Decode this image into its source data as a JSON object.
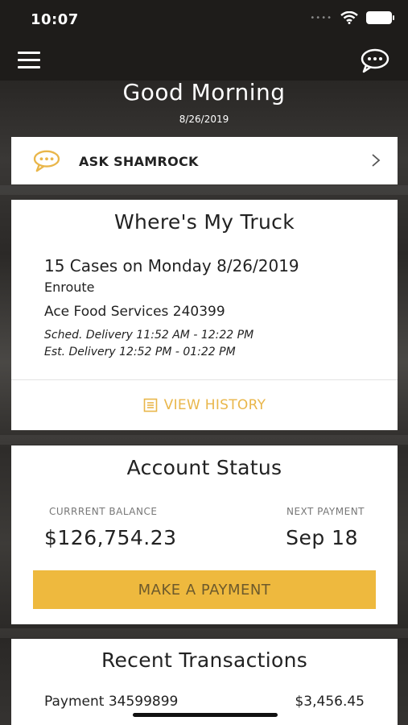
{
  "status_bar": {
    "time": "10:07"
  },
  "header": {
    "greeting": "Good Morning",
    "date": "8/26/2019"
  },
  "ask_shamrock": {
    "label": "ASK SHAMROCK"
  },
  "truck": {
    "title": "Where's My Truck",
    "cases": "15 Cases on Monday 8/26/2019",
    "status": "Enroute",
    "customer": "Ace Food Services 240399",
    "scheduled": "Sched. Delivery 11:52 AM - 12:22 PM",
    "estimated": "Est. Delivery 12:52 PM - 01:22 PM",
    "history_label": "VIEW HISTORY"
  },
  "account": {
    "title": "Account Status",
    "balance_label": "CURRRENT BALANCE",
    "balance_value": "$126,754.23",
    "payment_label": "NEXT PAYMENT",
    "payment_value": "Sep 18",
    "pay_button": "MAKE A PAYMENT"
  },
  "transactions": {
    "title": "Recent Transactions",
    "rows": [
      {
        "label": "Payment 34599899",
        "amount": "$3,456.45"
      }
    ]
  },
  "colors": {
    "accent": "#eeb93e",
    "accent_text": "#e9b64a",
    "nav": "#1e1c1a"
  },
  "icons": [
    "menu-icon",
    "chat-icon",
    "chevron-right-icon",
    "history-icon",
    "wifi-icon",
    "battery-icon"
  ]
}
